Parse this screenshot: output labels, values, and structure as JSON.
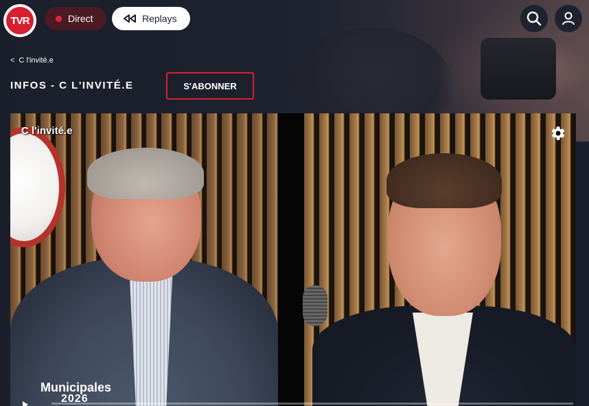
{
  "logo": {
    "text": "TVR",
    "color": "#d6202f"
  },
  "nav": {
    "direct_label": "Direct",
    "replays_label": "Replays",
    "live_dot_color": "#e0283a"
  },
  "icons": {
    "search": "search-icon",
    "user": "user-icon",
    "settings": "gear-icon",
    "rewind": "rewind-icon"
  },
  "breadcrumb": {
    "chevron": "<",
    "label": "C l'invité.e"
  },
  "page": {
    "title": "INFOS - C L'INVITÉ.E",
    "subscribe_label": "S'ABONNER",
    "accent": "#d6202f"
  },
  "video": {
    "title": "C l'invité.e",
    "overlay_line1": "Municipales",
    "overlay_line2": "2026"
  }
}
